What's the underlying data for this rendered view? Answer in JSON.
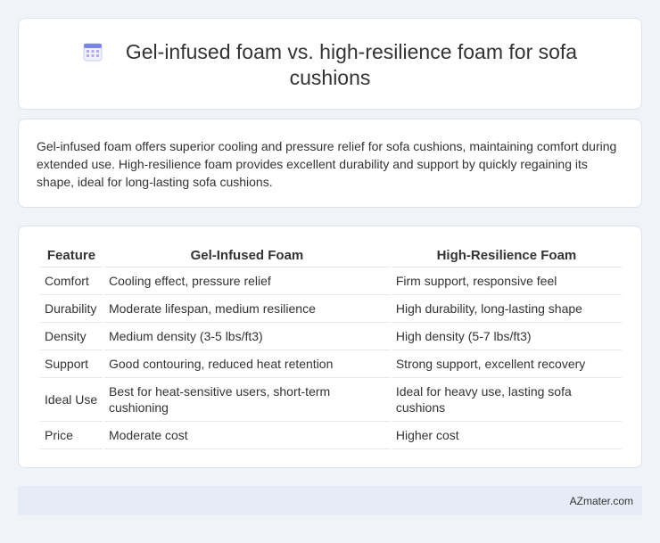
{
  "header": {
    "icon": "calendar-icon",
    "title": "Gel-infused foam vs. high-resilience foam for sofa cushions"
  },
  "description": "Gel-infused foam offers superior cooling and pressure relief for sofa cushions, maintaining comfort during extended use. High-resilience foam provides excellent durability and support by quickly regaining its shape, ideal for long-lasting sofa cushions.",
  "table": {
    "headers": [
      "Feature",
      "Gel-Infused Foam",
      "High-Resilience Foam"
    ],
    "rows": [
      [
        "Comfort",
        "Cooling effect, pressure relief",
        "Firm support, responsive feel"
      ],
      [
        "Durability",
        "Moderate lifespan, medium resilience",
        "High durability, long-lasting shape"
      ],
      [
        "Density",
        "Medium density (3-5 lbs/ft3)",
        "High density (5-7 lbs/ft3)"
      ],
      [
        "Support",
        "Good contouring, reduced heat retention",
        "Strong support, excellent recovery"
      ],
      [
        "Ideal Use",
        "Best for heat-sensitive users, short-term cushioning",
        "Ideal for heavy use, lasting sofa cushions"
      ],
      [
        "Price",
        "Moderate cost",
        "Higher cost"
      ]
    ]
  },
  "footer": {
    "brand": "AZmater.com"
  }
}
